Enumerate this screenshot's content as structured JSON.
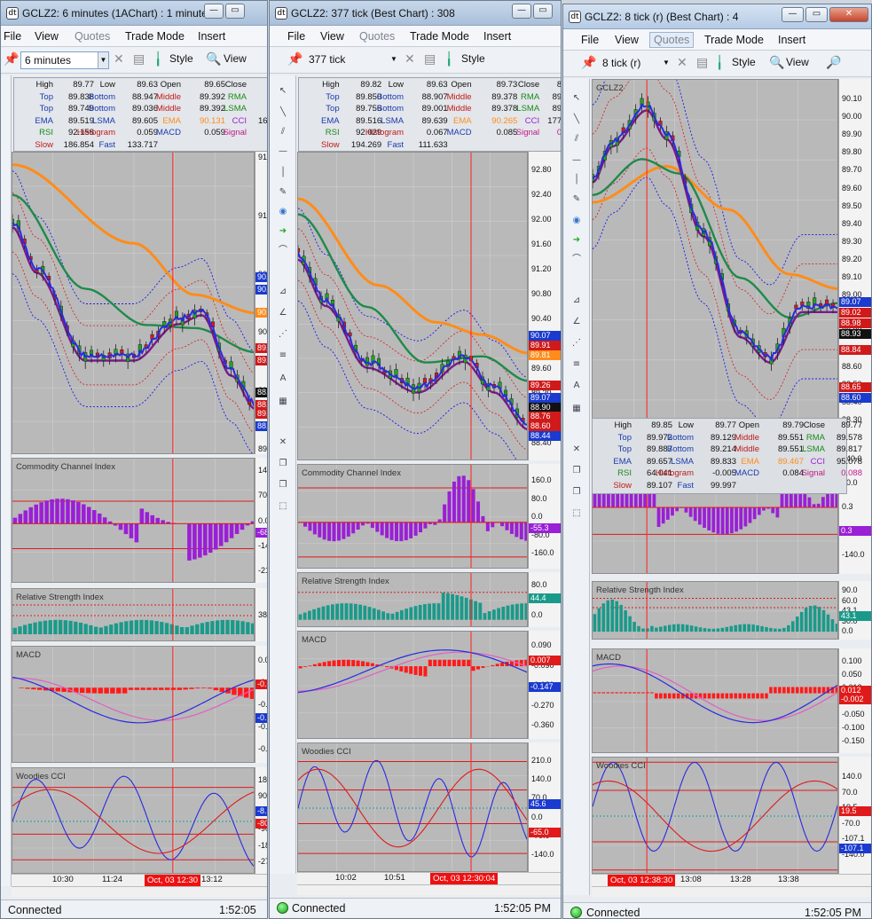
{
  "menu": {
    "file": "File",
    "view": "View",
    "quotes": "Quotes",
    "trade_mode": "Trade Mode",
    "insert": "Insert"
  },
  "toolbar": {
    "style": "Style",
    "view": "View"
  },
  "status": {
    "connected": "Connected",
    "time": "1:52:05 PM"
  },
  "panes": {
    "cci": "Commodity Channel Index",
    "rsi": "Relative Strength Index",
    "macd": "MACD",
    "woodies": "Woodies CCI"
  },
  "colors": {
    "plot_bg": "#b9b9b9",
    "price_line": "#2a2ae0",
    "purple_ma": "#7a1a8a",
    "green_ma": "#1f8a4a",
    "orange_ma": "#ff8c1a",
    "cci_hist": "#9a1fd6",
    "rsi_hist": "#1a9a8a",
    "macd_hist": "#ff1a1a",
    "cursor": "#ff2020"
  },
  "w1": {
    "title": "GCLZ2: 6 minutes (1AChart) : 1 minute...",
    "interval": "6 minutes",
    "info": [
      [
        "High",
        "89.77",
        "Low",
        "89.63",
        "Open",
        "89.65",
        "Close",
        "89.7"
      ],
      [
        "Top",
        "89.838",
        "Bottom",
        "88.947",
        "Middle",
        "89.392",
        "RMA",
        "89.6"
      ],
      [
        "Top",
        "89.749",
        "Bottom",
        "89.036",
        "Middle",
        "89.392",
        "LSMA",
        "89.5"
      ],
      [
        "EMA",
        "89.519",
        "LSMA",
        "89.605",
        "EMA",
        "90.131",
        "CCI",
        "167.46"
      ],
      [
        "RSI",
        "92.158",
        "Histogram",
        "0.059",
        "MACD",
        "0.059",
        "Signal",
        "0.0"
      ],
      [
        "Slow",
        "186.854",
        "Fast",
        "133.717"
      ]
    ],
    "price_ticks": [
      "91",
      "91",
      "90",
      "90",
      "89",
      "89"
    ],
    "price_tags": [
      "90.",
      "90.",
      "90.",
      "89.",
      "89.",
      "88.",
      "88.",
      "89.",
      "88."
    ],
    "cci_ticks": [
      "140",
      "70",
      "0.0",
      "-14",
      "-21"
    ],
    "cci_tag": "-68",
    "rsi_ticks": [
      "38"
    ],
    "macd_ticks": [
      "0.0",
      "-0.",
      "-0.",
      "-0.",
      "-0."
    ],
    "macd_tags": [
      "-0.",
      "-0."
    ],
    "wcci_ticks": [
      "180",
      "90",
      "-8.",
      "-90",
      "-18",
      "-27"
    ],
    "wcci_tags": [
      "-8.",
      "-80"
    ],
    "time_labels": [
      "10:30",
      "11:24",
      "13:12"
    ],
    "cursor_time": "Oct, 03 12:30"
  },
  "w2": {
    "title": "GCLZ2: 377 tick (Best Chart) : 308",
    "interval": "377 tick",
    "info": [
      [
        "High",
        "89.82",
        "Low",
        "89.63",
        "Open",
        "89.73",
        "Close",
        "89.81"
      ],
      [
        "Top",
        "89.850",
        "Bottom",
        "88.907",
        "Middle",
        "89.378",
        "RMA",
        "89.602"
      ],
      [
        "Top",
        "89.756",
        "Bottom",
        "89.001",
        "Middle",
        "89.378",
        "LSMA",
        "89.507"
      ],
      [
        "EMA",
        "89.516",
        "LSMA",
        "89.639",
        "EMA",
        "90.265",
        "CCI",
        "177.227"
      ],
      [
        "RSI",
        "92.029",
        "Histogram",
        "0.067",
        "MACD",
        "0.085",
        "Signal",
        "0.017"
      ],
      [
        "Slow",
        "194.269",
        "Fast",
        "111.633"
      ]
    ],
    "price_ticks": [
      "92.80",
      "92.40",
      "92.00",
      "91.60",
      "91.20",
      "90.80",
      "90.40",
      "90.00",
      "89.60",
      "89.20",
      "88.80",
      "88.40"
    ],
    "price_tags": [
      "90.07",
      "89.91",
      "89.81",
      "89.26",
      "89.07",
      "88.90",
      "88.76",
      "88.60",
      "88.44"
    ],
    "cci_ticks": [
      "160.0",
      "80.0",
      "0.0",
      "-80.0",
      "-160.0"
    ],
    "cci_tag": "-55.3",
    "rsi_ticks": [
      "80.0",
      "44.4",
      "0.0"
    ],
    "macd_ticks": [
      "0.090",
      "-0.090",
      "-0.180",
      "-0.270",
      "-0.360"
    ],
    "macd_tags": [
      "0.007",
      "-0.147"
    ],
    "wcci_ticks": [
      "210.0",
      "140.0",
      "70.0",
      "0.0",
      "-70.0",
      "-140.0"
    ],
    "wcci_tags": [
      "45.6",
      "-65.0"
    ],
    "time_labels": [
      "10:02",
      "10:51"
    ],
    "cursor_time": "Oct, 03 12:30:04"
  },
  "w3": {
    "title": "GCLZ2: 8 tick (r) (Best Chart) : 4",
    "interval": "8 tick (r)",
    "symbol": "GCLZ2",
    "info": [
      [
        "High",
        "89.85",
        "Low",
        "89.77",
        "Open",
        "89.79",
        "Close",
        "89.77"
      ],
      [
        "Top",
        "89.972",
        "Bottom",
        "89.129",
        "Middle",
        "89.551",
        "RMA",
        "89.578"
      ],
      [
        "Top",
        "89.887",
        "Bottom",
        "89.214",
        "Middle",
        "89.551",
        "LSMA",
        "89.817"
      ],
      [
        "EMA",
        "89.657",
        "LSMA",
        "89.833",
        "EMA",
        "89.467",
        "CCI",
        "95.078"
      ],
      [
        "RSI",
        "64.041",
        "Histogram",
        "-0.005",
        "MACD",
        "0.084",
        "Signal",
        "0.088"
      ],
      [
        "Slow",
        "89.107",
        "Fast",
        "99.997"
      ]
    ],
    "price_ticks": [
      "90.10",
      "90.00",
      "89.90",
      "89.80",
      "89.70",
      "89.60",
      "89.50",
      "89.40",
      "89.30",
      "89.20",
      "89.10",
      "89.00",
      "88.90",
      "88.80",
      "88.70",
      "88.60",
      "88.50",
      "88.40",
      "88.30"
    ],
    "price_tags": [
      "89.07",
      "89.02",
      "88.98",
      "88.93",
      "88.84",
      "88.65",
      "88.60"
    ],
    "cci_ticks": [
      "140.0",
      "70.0",
      "0.3",
      "-70.0",
      "-140.0"
    ],
    "cci_tag": "0.3",
    "rsi_ticks": [
      "90.0",
      "60.0",
      "43.1",
      "30.0",
      "0.0"
    ],
    "macd_ticks": [
      "0.100",
      "0.050",
      "0.012",
      "-0.002",
      "-0.050",
      "-0.100",
      "-0.150"
    ],
    "macd_tags": [
      "0.012",
      "-0.002"
    ],
    "wcci_ticks": [
      "140.0",
      "70.0",
      "19.5",
      "-70.0",
      "-107.1",
      "-140.0"
    ],
    "wcci_tags": [
      "19.5",
      "-107.1"
    ],
    "time_labels": [
      "13:08",
      "13:28",
      "13:38"
    ],
    "cursor_time": "Oct, 03 12:38:30"
  }
}
